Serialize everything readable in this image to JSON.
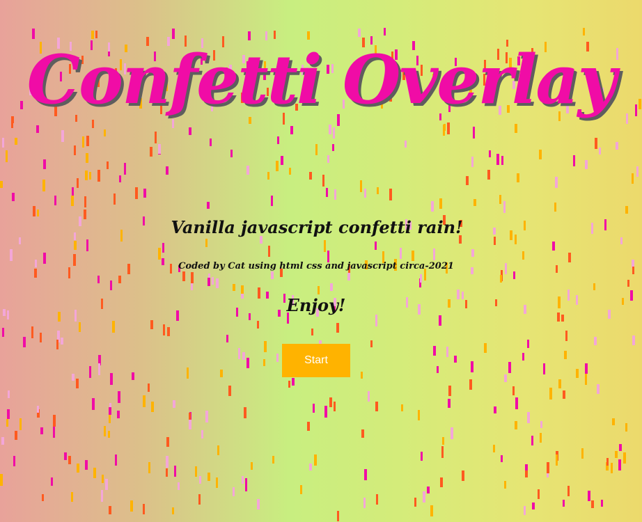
{
  "page": {
    "title": "Confetti Overlay",
    "subtitle": "Vanilla javascript confetti rain!",
    "credit": "Coded by Cat using html css and javascript circa-2021",
    "enjoy": "Enjoy!"
  },
  "controls": {
    "start_label": "Start"
  },
  "colors": {
    "title": "#f00ca6",
    "button": "#ffb300",
    "confetti": [
      "#f00ca6",
      "#ff5a1f",
      "#ffb300",
      "#f3a6d8"
    ]
  }
}
